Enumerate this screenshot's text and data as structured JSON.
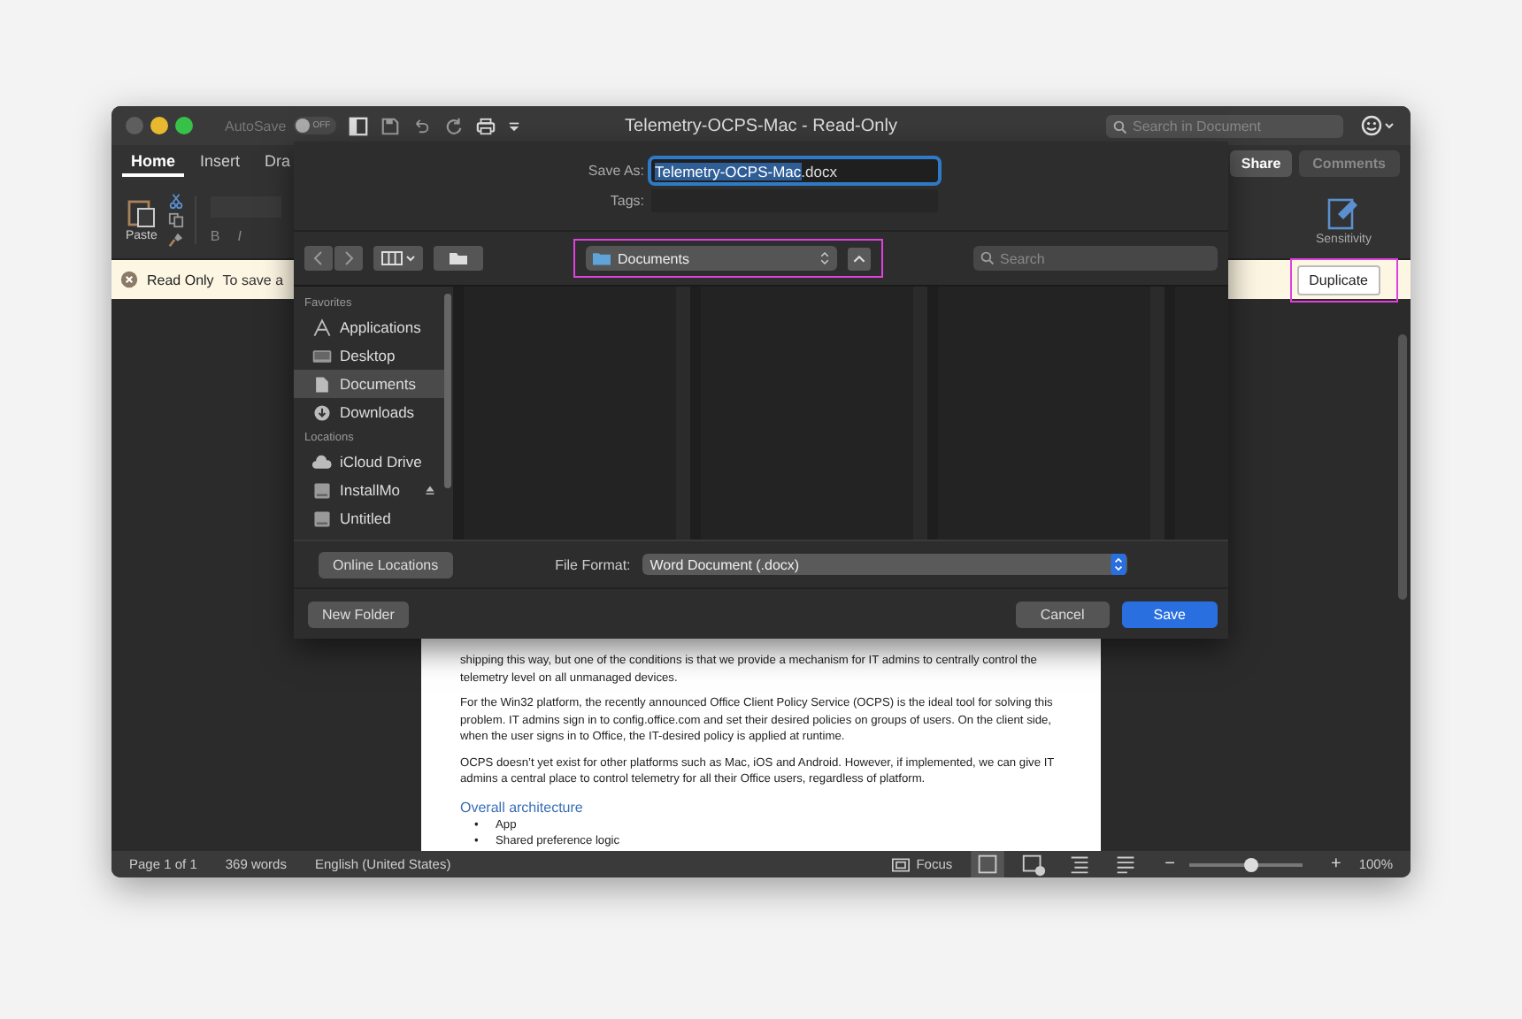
{
  "window": {
    "title": "Telemetry-OCPS-Mac  -  Read-Only",
    "autosave": {
      "label": "AutoSave",
      "state": "OFF"
    },
    "search": {
      "placeholder": "Search in Document"
    }
  },
  "ribbon": {
    "tabs": [
      {
        "label": "Home",
        "selected": true
      },
      {
        "label": "Insert",
        "selected": false
      },
      {
        "label": "Dra",
        "selected": false
      }
    ],
    "paste": "Paste",
    "bold": "B",
    "italic": "I",
    "share": "Share",
    "comments": "Comments",
    "sensitivity": "Sensitivity"
  },
  "readonly_bar": {
    "title": "Read Only",
    "message": "To save a",
    "button": {
      "label": "Duplicate",
      "highlighted": true
    }
  },
  "dialog": {
    "save_as": {
      "label": "Save As:",
      "selected_text": "Telemetry-OCPS-Mac",
      "rest_text": ".docx"
    },
    "tags": {
      "label": "Tags:"
    },
    "location": {
      "label": "Documents",
      "highlighted": true
    },
    "search": {
      "placeholder": "Search"
    },
    "sidebar": [
      {
        "heading": "Favorites",
        "items": [
          {
            "label": "Applications",
            "kind": "apps",
            "selected": false
          },
          {
            "label": "Desktop",
            "kind": "desktop",
            "selected": false
          },
          {
            "label": "Documents",
            "kind": "documents",
            "selected": true
          },
          {
            "label": "Downloads",
            "kind": "downloads",
            "selected": false
          }
        ]
      },
      {
        "heading": "Locations",
        "items": [
          {
            "label": "iCloud Drive",
            "kind": "cloud",
            "selected": false
          },
          {
            "label": "InstallMo",
            "kind": "disk-eject",
            "selected": false
          },
          {
            "label": "Untitled",
            "kind": "disk",
            "selected": false
          }
        ]
      }
    ],
    "online_locations": "Online Locations",
    "file_format": {
      "label": "File Format:",
      "value": "Word Document (.docx)"
    },
    "new_folder": "New Folder",
    "cancel": "Cancel",
    "save": "Save"
  },
  "document": {
    "blocks": [
      {
        "kind": "p",
        "text": "shipping this way, but one of the conditions is that we provide a mechanism for IT admins to centrally control the telemetry level on all unmanaged devices."
      },
      {
        "kind": "p",
        "text": "For the Win32 platform, the recently announced Office Client Policy Service (OCPS) is the ideal tool for solving this problem. IT admins sign in to config.office.com and set their desired policies on groups of users. On the client side, when the user signs in to Office, the IT-desired policy is applied at runtime."
      },
      {
        "kind": "p",
        "text": "OCPS doesn’t yet exist for other platforms such as Mac, iOS and Android. However, if implemented, we can give IT admins a central place to control telemetry for all their Office users, regardless of platform."
      },
      {
        "kind": "h",
        "text": "Overall architecture"
      },
      {
        "kind": "li",
        "marker": "•",
        "text": "App"
      },
      {
        "kind": "li",
        "marker": "•",
        "text": "Shared preference logic"
      }
    ]
  },
  "status_bar": {
    "page": "Page 1 of 1",
    "words": "369 words",
    "language": "English (United States)",
    "focus": "Focus",
    "zoom": {
      "out": "−",
      "in": "+",
      "level": 0.55,
      "reading": "100%"
    }
  }
}
